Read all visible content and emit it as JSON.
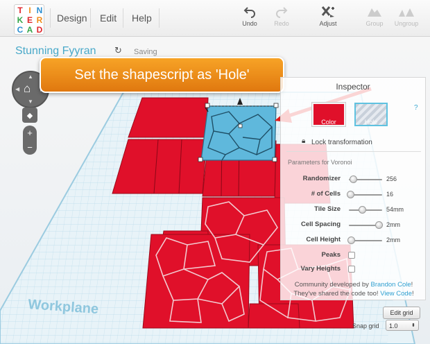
{
  "app": {
    "logo_letters": [
      "T",
      "I",
      "N",
      "K",
      "E",
      "R",
      "C",
      "A",
      "D"
    ],
    "logo_colors": [
      "#e0252b",
      "#f08c1a",
      "#2c8fd1",
      "#35a64a",
      "#e0252b",
      "#f08c1a",
      "#2c8fd1",
      "#35a64a",
      "#e0252b"
    ]
  },
  "menu": {
    "design": "Design",
    "edit": "Edit",
    "help": "Help"
  },
  "toolbar": {
    "undo": "Undo",
    "redo": "Redo",
    "adjust": "Adjust",
    "group": "Group",
    "ungroup": "Ungroup"
  },
  "design": {
    "title": "Stunning Fyyran",
    "status": "Saving",
    "refresh_icon": "↻"
  },
  "callout": {
    "text": "Set the shapescript as 'Hole'"
  },
  "inspector": {
    "title": "Inspector",
    "color_label": "Color",
    "hole_label": "Hole",
    "help": "?",
    "lock_label": "Lock transformation",
    "params_title": "Parameters for Voronoi",
    "params": [
      {
        "label": "Randomizer",
        "value": "256",
        "fraction": 0.12
      },
      {
        "label": "# of Cells",
        "value": "16",
        "fraction": 0.05
      },
      {
        "label": "Tile Size",
        "value": "54mm",
        "fraction": 0.4
      },
      {
        "label": "Cell Spacing",
        "value": "2mm",
        "fraction": 0.9
      },
      {
        "label": "Cell Height",
        "value": "2mm",
        "fraction": 0.06
      }
    ],
    "checkboxes": [
      {
        "label": "Peaks",
        "checked": false
      },
      {
        "label": "Vary Heights",
        "checked": false
      }
    ],
    "community_prefix": "Community developed by ",
    "community_author": "Brandon Cole",
    "community_suffix": "!",
    "shared_prefix": "They've shared the code too! ",
    "shared_link": "View Code",
    "shared_suffix": "!"
  },
  "grid": {
    "workplane_label": "Workplane",
    "edit_grid": "Edit grid",
    "snap_label": "Snap grid",
    "snap_value": "1.0"
  },
  "colors": {
    "shape_red": "#e0102a",
    "accent_blue": "#49a9c9",
    "callout_orange": "#f0901c"
  }
}
